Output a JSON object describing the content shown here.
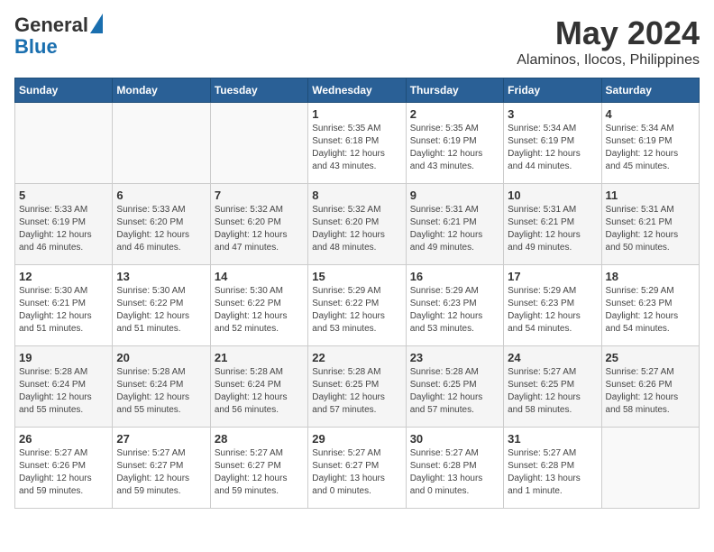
{
  "header": {
    "logo_general": "General",
    "logo_blue": "Blue",
    "month": "May 2024",
    "location": "Alaminos, Ilocos, Philippines"
  },
  "weekdays": [
    "Sunday",
    "Monday",
    "Tuesday",
    "Wednesday",
    "Thursday",
    "Friday",
    "Saturday"
  ],
  "weeks": [
    [
      {
        "day": "",
        "info": ""
      },
      {
        "day": "",
        "info": ""
      },
      {
        "day": "",
        "info": ""
      },
      {
        "day": "1",
        "info": "Sunrise: 5:35 AM\nSunset: 6:18 PM\nDaylight: 12 hours\nand 43 minutes."
      },
      {
        "day": "2",
        "info": "Sunrise: 5:35 AM\nSunset: 6:19 PM\nDaylight: 12 hours\nand 43 minutes."
      },
      {
        "day": "3",
        "info": "Sunrise: 5:34 AM\nSunset: 6:19 PM\nDaylight: 12 hours\nand 44 minutes."
      },
      {
        "day": "4",
        "info": "Sunrise: 5:34 AM\nSunset: 6:19 PM\nDaylight: 12 hours\nand 45 minutes."
      }
    ],
    [
      {
        "day": "5",
        "info": "Sunrise: 5:33 AM\nSunset: 6:19 PM\nDaylight: 12 hours\nand 46 minutes."
      },
      {
        "day": "6",
        "info": "Sunrise: 5:33 AM\nSunset: 6:20 PM\nDaylight: 12 hours\nand 46 minutes."
      },
      {
        "day": "7",
        "info": "Sunrise: 5:32 AM\nSunset: 6:20 PM\nDaylight: 12 hours\nand 47 minutes."
      },
      {
        "day": "8",
        "info": "Sunrise: 5:32 AM\nSunset: 6:20 PM\nDaylight: 12 hours\nand 48 minutes."
      },
      {
        "day": "9",
        "info": "Sunrise: 5:31 AM\nSunset: 6:21 PM\nDaylight: 12 hours\nand 49 minutes."
      },
      {
        "day": "10",
        "info": "Sunrise: 5:31 AM\nSunset: 6:21 PM\nDaylight: 12 hours\nand 49 minutes."
      },
      {
        "day": "11",
        "info": "Sunrise: 5:31 AM\nSunset: 6:21 PM\nDaylight: 12 hours\nand 50 minutes."
      }
    ],
    [
      {
        "day": "12",
        "info": "Sunrise: 5:30 AM\nSunset: 6:21 PM\nDaylight: 12 hours\nand 51 minutes."
      },
      {
        "day": "13",
        "info": "Sunrise: 5:30 AM\nSunset: 6:22 PM\nDaylight: 12 hours\nand 51 minutes."
      },
      {
        "day": "14",
        "info": "Sunrise: 5:30 AM\nSunset: 6:22 PM\nDaylight: 12 hours\nand 52 minutes."
      },
      {
        "day": "15",
        "info": "Sunrise: 5:29 AM\nSunset: 6:22 PM\nDaylight: 12 hours\nand 53 minutes."
      },
      {
        "day": "16",
        "info": "Sunrise: 5:29 AM\nSunset: 6:23 PM\nDaylight: 12 hours\nand 53 minutes."
      },
      {
        "day": "17",
        "info": "Sunrise: 5:29 AM\nSunset: 6:23 PM\nDaylight: 12 hours\nand 54 minutes."
      },
      {
        "day": "18",
        "info": "Sunrise: 5:29 AM\nSunset: 6:23 PM\nDaylight: 12 hours\nand 54 minutes."
      }
    ],
    [
      {
        "day": "19",
        "info": "Sunrise: 5:28 AM\nSunset: 6:24 PM\nDaylight: 12 hours\nand 55 minutes."
      },
      {
        "day": "20",
        "info": "Sunrise: 5:28 AM\nSunset: 6:24 PM\nDaylight: 12 hours\nand 55 minutes."
      },
      {
        "day": "21",
        "info": "Sunrise: 5:28 AM\nSunset: 6:24 PM\nDaylight: 12 hours\nand 56 minutes."
      },
      {
        "day": "22",
        "info": "Sunrise: 5:28 AM\nSunset: 6:25 PM\nDaylight: 12 hours\nand 57 minutes."
      },
      {
        "day": "23",
        "info": "Sunrise: 5:28 AM\nSunset: 6:25 PM\nDaylight: 12 hours\nand 57 minutes."
      },
      {
        "day": "24",
        "info": "Sunrise: 5:27 AM\nSunset: 6:25 PM\nDaylight: 12 hours\nand 58 minutes."
      },
      {
        "day": "25",
        "info": "Sunrise: 5:27 AM\nSunset: 6:26 PM\nDaylight: 12 hours\nand 58 minutes."
      }
    ],
    [
      {
        "day": "26",
        "info": "Sunrise: 5:27 AM\nSunset: 6:26 PM\nDaylight: 12 hours\nand 59 minutes."
      },
      {
        "day": "27",
        "info": "Sunrise: 5:27 AM\nSunset: 6:27 PM\nDaylight: 12 hours\nand 59 minutes."
      },
      {
        "day": "28",
        "info": "Sunrise: 5:27 AM\nSunset: 6:27 PM\nDaylight: 12 hours\nand 59 minutes."
      },
      {
        "day": "29",
        "info": "Sunrise: 5:27 AM\nSunset: 6:27 PM\nDaylight: 13 hours\nand 0 minutes."
      },
      {
        "day": "30",
        "info": "Sunrise: 5:27 AM\nSunset: 6:28 PM\nDaylight: 13 hours\nand 0 minutes."
      },
      {
        "day": "31",
        "info": "Sunrise: 5:27 AM\nSunset: 6:28 PM\nDaylight: 13 hours\nand 1 minute."
      },
      {
        "day": "",
        "info": ""
      }
    ]
  ]
}
